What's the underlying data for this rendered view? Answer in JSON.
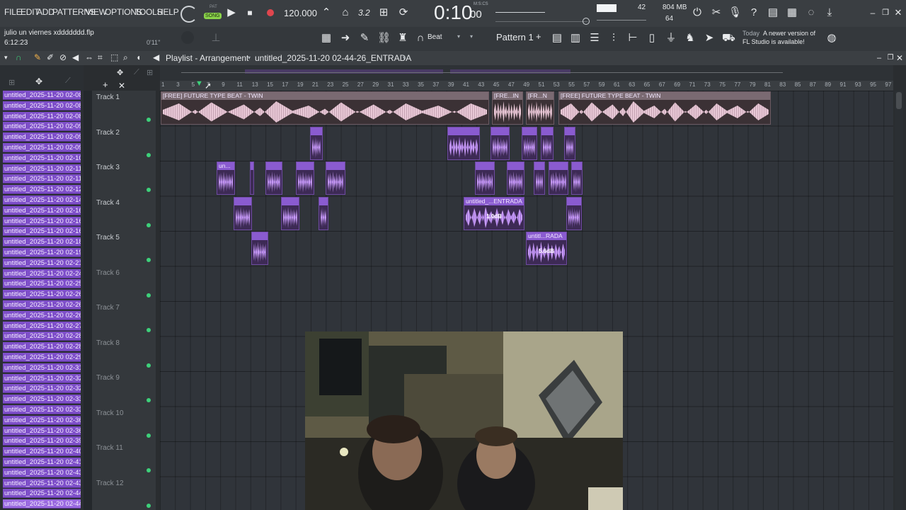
{
  "menu": [
    "FILE",
    "EDIT",
    "ADD",
    "PATTERNS",
    "VIEW",
    "OPTIONS",
    "TOOLS",
    "HELP"
  ],
  "transport": {
    "pat_label": "PAT",
    "song_label": "SONG",
    "tempo": "120.000",
    "time": "0:10",
    "time_sub": "00",
    "mcs": "M:S:CS",
    "step_label": "3.2"
  },
  "monitor": {
    "cpu": "42",
    "mem": "804 MB",
    "poly": "64"
  },
  "project": {
    "name": "julio un viernes xddddddd.flp",
    "length": "6:12:23",
    "hint_time": "0'11\""
  },
  "snap": {
    "label": "Beat"
  },
  "pattern": {
    "label": "Pattern 1",
    "add": "+"
  },
  "news": {
    "today": "Today",
    "message": "A newer version of",
    "message2": "FL Studio is available!"
  },
  "playlist": {
    "title": "Playlist - Arrangement",
    "file": "untitled_2025-11-20 02-44-26_ENTRADA"
  },
  "files": [
    "untitled_2025-11-20 02-08...",
    "untitled_2025-11-20 02-08...",
    "untitled_2025-11-20 02-08...",
    "untitled_2025-11-20 02-09...",
    "untitled_2025-11-20 02-09...",
    "untitled_2025-11-20 02-09...",
    "untitled_2025-11-20 02-10...",
    "untitled_2025-11-20 02-11...",
    "untitled_2025-11-20 02-11...",
    "untitled_2025-11-20 02-12...",
    "untitled_2025-11-20 02-14...",
    "untitled_2025-11-20 02-16...",
    "untitled_2025-11-20 02-16...",
    "untitled_2025-11-20 02-16...",
    "untitled_2025-11-20 02-18...",
    "untitled_2025-11-20 02-19...",
    "untitled_2025-11-20 02-21...",
    "untitled_2025-11-20 02-24...",
    "untitled_2025-11-20 02-25...",
    "untitled_2025-11-20 02-26...",
    "untitled_2025-11-20 02-26...",
    "untitled_2025-11-20 02-26...",
    "untitled_2025-11-20 02-27...",
    "untitled_2025-11-20 02-28...",
    "untitled_2025-11-20 02-28...",
    "untitled_2025-11-20 02-29...",
    "untitled_2025-11-20 02-31...",
    "untitled_2025-11-20 02-32...",
    "untitled_2025-11-20 02-32...",
    "untitled_2025-11-20 02-33...",
    "untitled_2025-11-20 02-33...",
    "untitled_2025-11-20 02-36...",
    "untitled_2025-11-20 02-36...",
    "untitled_2025-11-20 02-39...",
    "untitled_2025-11-20 02-40...",
    "untitled_2025-11-20 02-41...",
    "untitled_2025-11-20 02-43...",
    "untitled_2025-11-20 02-43...",
    "untitled_2025-11-20 02-44...",
    "untitled_2025-11-20 02-44..."
  ],
  "tracks": [
    "Track 1",
    "Track 2",
    "Track 3",
    "Track 4",
    "Track 5",
    "Track 6",
    "Track 7",
    "Track 8",
    "Track 9",
    "Track 10",
    "Track 11",
    "Track 12"
  ],
  "ruler": [
    "1",
    "3",
    "5",
    "7",
    "9",
    "11",
    "13",
    "15",
    "17",
    "19",
    "21",
    "23",
    "25",
    "27",
    "29",
    "31",
    "33",
    "35",
    "37",
    "39",
    "41",
    "43",
    "45",
    "47",
    "49",
    "51",
    "53",
    "55",
    "57",
    "59",
    "61",
    "63",
    "65",
    "67",
    "69",
    "71",
    "73",
    "75",
    "77",
    "79",
    "81",
    "83",
    "85",
    "87",
    "89",
    "91",
    "93",
    "95",
    "97"
  ],
  "clips": {
    "beat_a": "[FREE] FUTURE TYPE BEAT - TWIN",
    "beat_b": "[FRE...IN",
    "beat_c": "[FR...N",
    "beat_d": "[FREE] FUTURE TYPE BEAT - TWIN",
    "entrada": "untitled_...ENTRADA",
    "entrada_db": "1.0dB",
    "rada": "untitl...RADA",
    "rada_db": "5.6dB",
    "un": "un..."
  },
  "colors": {
    "accent": "#8a5bd0",
    "clip_bg": "#3d2a55",
    "file_bg": "#7e4fc9",
    "active": "#3dd17a"
  }
}
